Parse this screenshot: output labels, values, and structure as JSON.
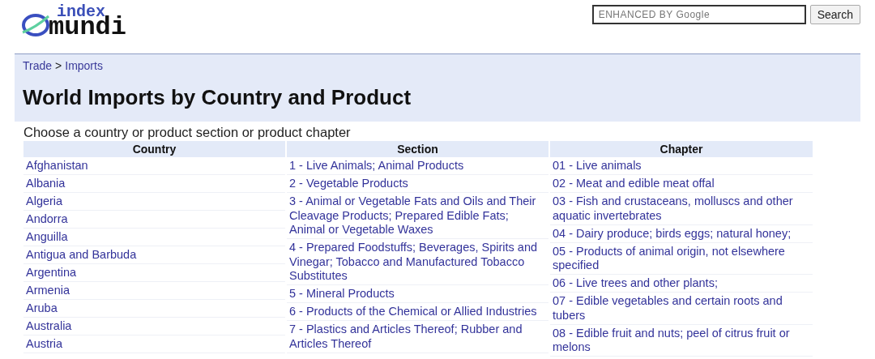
{
  "logo": {
    "top": "index",
    "bottom": "mundi"
  },
  "search": {
    "placeholder": "ENHANCED BY Google",
    "button": "Search"
  },
  "breadcrumb": [
    {
      "label": "Trade"
    },
    {
      "label": ">",
      "kind": "separator"
    },
    {
      "label": "Imports"
    }
  ],
  "title": "World Imports by Country and Product",
  "intro": "Choose a country or product section or product chapter",
  "columns": [
    {
      "heading": "Country",
      "items": [
        "Afghanistan",
        "Albania",
        "Algeria",
        "Andorra",
        "Anguilla",
        "Antigua and Barbuda",
        "Argentina",
        "Armenia",
        "Aruba",
        "Australia",
        "Austria"
      ]
    },
    {
      "heading": "Section",
      "items": [
        "1 - Live Animals; Animal Products",
        "2 - Vegetable Products",
        "3 - Animal or Vegetable Fats and Oils and Their Cleavage Products; Prepared Edible Fats; Animal or Vegetable Waxes",
        "4 - Prepared Foodstuffs; Beverages, Spirits and Vinegar; Tobacco and Manufactured Tobacco Substitutes",
        "5 - Mineral Products",
        "6 - Products of the Chemical or Allied Industries",
        "7 - Plastics and Articles Thereof; Rubber and Articles Thereof"
      ]
    },
    {
      "heading": "Chapter",
      "items": [
        "01 - Live animals",
        "02 - Meat and edible meat offal",
        "03 - Fish and crustaceans, molluscs and other aquatic invertebrates",
        "04 - Dairy produce; birds eggs; natural honey;",
        "05 - Products of animal origin, not elsewhere specified",
        "06 - Live trees and other plants;",
        "07 - Edible vegetables and certain roots and tubers",
        "08 - Edible fruit and nuts; peel of citrus fruit or melons"
      ]
    }
  ]
}
